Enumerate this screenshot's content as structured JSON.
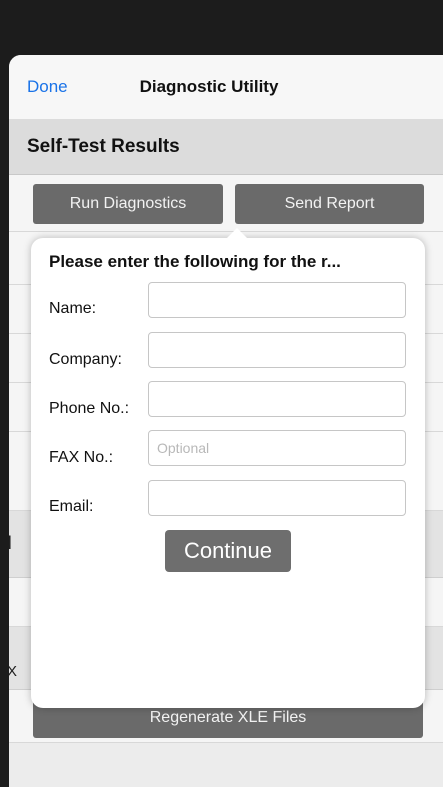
{
  "nav": {
    "done_label": "Done",
    "title": "Diagnostic Utility"
  },
  "section": {
    "title": "Self-Test Results"
  },
  "toolbar": {
    "run_diagnostics_label": "Run Diagnostics",
    "send_report_label": "Send Report"
  },
  "background": {
    "partial_letter_1": "I",
    "partial_letter_2": "X",
    "regenerate_label": "Regenerate XLE Files"
  },
  "popover": {
    "title": "Please enter the following for the r...",
    "fields": {
      "name": {
        "label": "Name:",
        "value": "",
        "placeholder": ""
      },
      "company": {
        "label": "Company:",
        "value": "",
        "placeholder": ""
      },
      "phone": {
        "label": "Phone No.:",
        "value": "",
        "placeholder": ""
      },
      "fax": {
        "label": "FAX No.:",
        "value": "",
        "placeholder": "Optional"
      },
      "email": {
        "label": "Email:",
        "value": "",
        "placeholder": ""
      }
    },
    "continue_label": "Continue"
  }
}
